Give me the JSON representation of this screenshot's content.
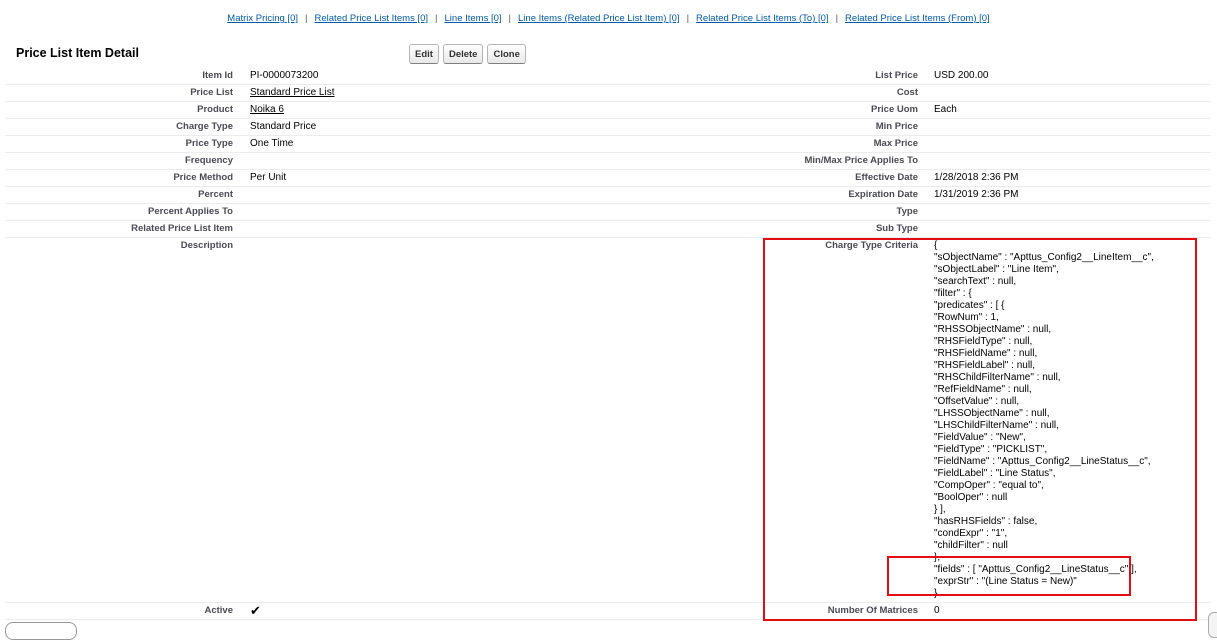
{
  "related_links": [
    {
      "label": "Matrix Pricing",
      "count": "[0]"
    },
    {
      "label": "Related Price List Items",
      "count": "[0]"
    },
    {
      "label": "Line Items",
      "count": "[0]"
    },
    {
      "label": "Line Items (Related Price List Item)",
      "count": "[0]"
    },
    {
      "label": "Related Price List Items (To)",
      "count": "[0]"
    },
    {
      "label": "Related Price List Items (From)",
      "count": "[0]"
    }
  ],
  "separator": "|",
  "page_title": "Price List Item Detail",
  "buttons": {
    "edit": "Edit",
    "delete": "Delete",
    "clone": "Clone"
  },
  "rows": [
    {
      "l1": "Item Id",
      "v1": "PI-0000073200",
      "l2": "List Price",
      "v2": "USD 200.00"
    },
    {
      "l1": "Price List",
      "v1": "Standard Price List",
      "v1_link": true,
      "l2": "Cost",
      "v2": ""
    },
    {
      "l1": "Product",
      "v1": "Noika 6",
      "v1_link": true,
      "l2": "Price Uom",
      "v2": "Each"
    },
    {
      "l1": "Charge Type",
      "v1": "Standard Price",
      "l2": "Min Price",
      "v2": ""
    },
    {
      "l1": "Price Type",
      "v1": "One Time",
      "l2": "Max Price",
      "v2": ""
    },
    {
      "l1": "Frequency",
      "v1": "",
      "l2": "Min/Max Price Applies To",
      "v2": ""
    },
    {
      "l1": "Price Method",
      "v1": "Per Unit",
      "l2": "Effective Date",
      "v2": "1/28/2018 2:36 PM"
    },
    {
      "l1": "Percent",
      "v1": "",
      "l2": "Expiration Date",
      "v2": "1/31/2019 2:36 PM"
    },
    {
      "l1": "Percent Applies To",
      "v1": "",
      "l2": "Type",
      "v2": ""
    },
    {
      "l1": "Related Price List Item",
      "v1": "",
      "l2": "Sub Type",
      "v2": ""
    }
  ],
  "description": {
    "label": "Description",
    "value": ""
  },
  "charge_type_criteria": {
    "label": "Charge Type Criteria",
    "lines": [
      "{",
      "\"sObjectName\" : \"Apttus_Config2__LineItem__c\",",
      "\"sObjectLabel\" : \"Line Item\",",
      "\"searchText\" : null,",
      "\"filter\" : {",
      "\"predicates\" : [ {",
      "\"RowNum\" : 1,",
      "\"RHSSObjectName\" : null,",
      "\"RHSFieldType\" : null,",
      "\"RHSFieldName\" : null,",
      "\"RHSFieldLabel\" : null,",
      "\"RHSChildFilterName\" : null,",
      "\"RefFieldName\" : null,",
      "\"OffsetValue\" : null,",
      "\"LHSSObjectName\" : null,",
      "\"LHSChildFilterName\" : null,",
      "\"FieldValue\" : \"New\",",
      "\"FieldType\" : \"PICKLIST\",",
      "\"FieldName\" : \"Apttus_Config2__LineStatus__c\",",
      "\"FieldLabel\" : \"Line Status\",",
      "\"CompOper\" : \"equal to\",",
      "\"BoolOper\" : null",
      "} ],",
      "\"hasRHSFields\" : false,",
      "\"condExpr\" : \"1\",",
      "\"childFilter\" : null",
      "},",
      "\"fields\" : [ \"Apttus_Config2__LineStatus__c\" ],",
      "\"exprStr\" : \"(Line Status = New)\"",
      "}"
    ]
  },
  "last_row": {
    "l1": "Active",
    "v1_checked": true,
    "l2": "Number Of Matrices",
    "v2": "0"
  },
  "highlight_color": "#e30d16",
  "link_color": "#015ba7",
  "icons": {
    "checkmark": "checkmark-icon"
  }
}
